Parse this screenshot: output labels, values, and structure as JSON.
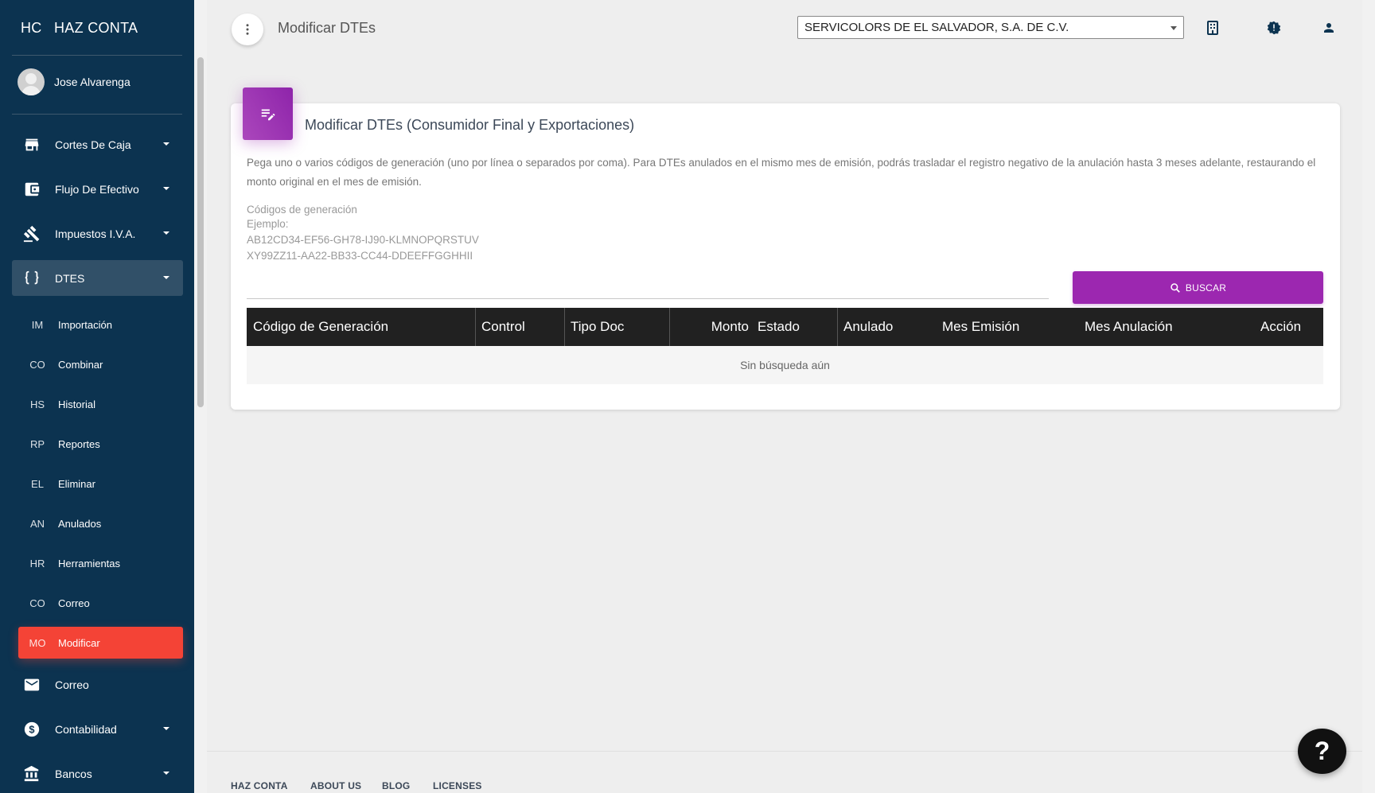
{
  "brand": {
    "mini": "HC",
    "name": "HAZ CONTA"
  },
  "user": {
    "name": "Jose Alvarenga"
  },
  "sidebar": {
    "items": [
      {
        "label": "Cortes De Caja",
        "icon": "store-icon"
      },
      {
        "label": "Flujo De Efectivo",
        "icon": "wallet-icon"
      },
      {
        "label": "Impuestos I.V.A.",
        "icon": "gavel-icon"
      },
      {
        "label": "DTES",
        "icon": "code-braces-icon"
      }
    ],
    "dtes_sub": [
      {
        "mini": "IM",
        "label": "Importación"
      },
      {
        "mini": "CO",
        "label": "Combinar"
      },
      {
        "mini": "HS",
        "label": "Historial"
      },
      {
        "mini": "RP",
        "label": "Reportes"
      },
      {
        "mini": "EL",
        "label": "Eliminar"
      },
      {
        "mini": "AN",
        "label": "Anulados"
      },
      {
        "mini": "HR",
        "label": "Herramientas"
      },
      {
        "mini": "CO",
        "label": "Correo"
      },
      {
        "mini": "MO",
        "label": "Modificar"
      }
    ],
    "items_after": [
      {
        "label": "Correo",
        "icon": "mail-icon"
      },
      {
        "label": "Contabilidad",
        "icon": "dollar-icon"
      },
      {
        "label": "Bancos",
        "icon": "bank-icon"
      }
    ]
  },
  "topbar": {
    "title": "Modificar DTEs",
    "company": "SERVICOLORS DE EL SALVADOR, S.A. DE C.V."
  },
  "card": {
    "title": "Modificar DTEs (Consumidor Final y Exportaciones)",
    "description": "Pega uno o varios códigos de generación (uno por línea o separados por coma). Para DTEs anulados en el mismo mes de emisión, podrás trasladar el registro negativo de la anulación hasta 3 meses adelante, restaurando el monto original en el mes de emisión.",
    "codes_label": "Códigos de generación",
    "codes_example_label": "Ejemplo:",
    "codes_example_1": "AB12CD34-EF56-GH78-IJ90-KLMNOPQRSTUV",
    "codes_example_2": "XY99ZZ11-AA22-BB33-CC44-DDEEFFGGHHII",
    "search_button": "BUSCAR"
  },
  "table": {
    "columns": [
      "Código de Generación",
      "Control",
      "Tipo Doc",
      "Monto",
      "Estado",
      "Anulado",
      "Mes Emisión",
      "Mes Anulación",
      "Acción"
    ],
    "empty_text": "Sin búsqueda aún"
  },
  "footer": {
    "links": [
      "HAZ CONTA",
      "ABOUT US",
      "BLOG",
      "LICENSES"
    ]
  },
  "help": {
    "label": "?"
  },
  "colors": {
    "sidebar": "#0c3350",
    "accent": "#9c27b0",
    "active": "#f44336"
  }
}
